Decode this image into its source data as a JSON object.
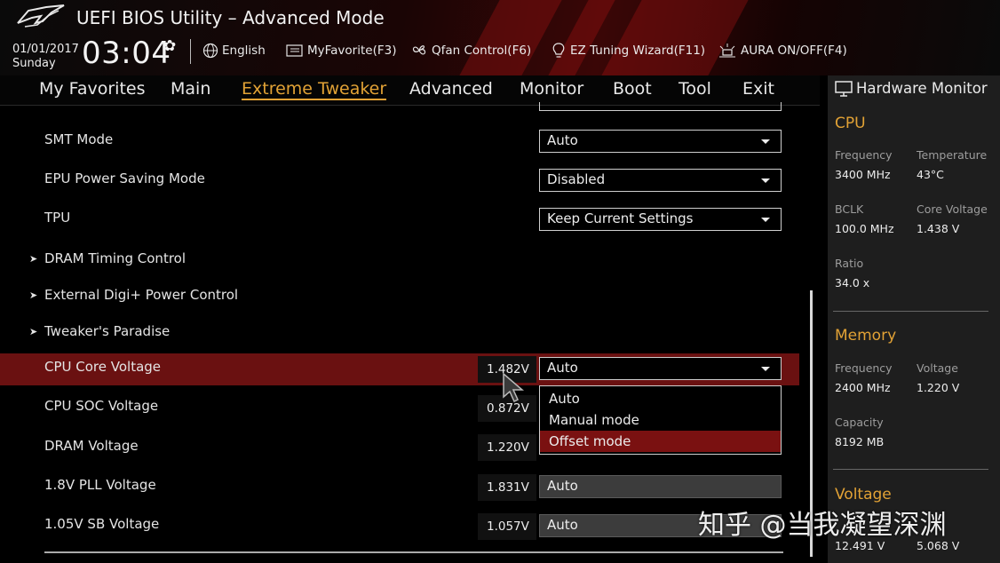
{
  "header": {
    "title": "UEFI BIOS Utility – Advanced Mode",
    "date": "01/01/2017",
    "day": "Sunday",
    "time": "03:04",
    "buttons": {
      "language": "English",
      "my_favorite": "MyFavorite(F3)",
      "qfan": "Qfan Control(F6)",
      "ez_tuning": "EZ Tuning Wizard(F11)",
      "aura": "AURA ON/OFF(F4)"
    }
  },
  "tabs": [
    {
      "label": "My Favorites"
    },
    {
      "label": "Main"
    },
    {
      "label": "Extreme Tweaker",
      "active": true
    },
    {
      "label": "Advanced"
    },
    {
      "label": "Monitor"
    },
    {
      "label": "Boot"
    },
    {
      "label": "Tool"
    },
    {
      "label": "Exit"
    }
  ],
  "settings": {
    "smt_mode": {
      "label": "SMT Mode",
      "value": "Auto"
    },
    "epu_power_saving": {
      "label": "EPU Power Saving Mode",
      "value": "Disabled"
    },
    "tpu": {
      "label": "TPU",
      "value": "Keep Current Settings"
    },
    "dram_timing": {
      "label": "DRAM Timing Control"
    },
    "external_digi": {
      "label": "External Digi+ Power Control"
    },
    "tweakers_paradise": {
      "label": "Tweaker's Paradise"
    },
    "cpu_core_voltage": {
      "label": "CPU Core Voltage",
      "reading": "1.482V",
      "value": "Auto"
    },
    "cpu_soc_voltage": {
      "label": "CPU SOC Voltage",
      "reading": "0.872V"
    },
    "dram_voltage": {
      "label": "DRAM Voltage",
      "reading": "1.220V"
    },
    "pll_voltage": {
      "label": "1.8V PLL Voltage",
      "reading": "1.831V",
      "value": "Auto"
    },
    "sb_voltage": {
      "label": "1.05V SB Voltage",
      "reading": "1.057V",
      "value": "Auto"
    }
  },
  "dropdown_options": [
    "Auto",
    "Manual mode",
    "Offset mode"
  ],
  "dropdown_selected": "Offset mode",
  "hardware_monitor": {
    "title": "Hardware Monitor",
    "cpu": {
      "heading": "CPU",
      "frequency_label": "Frequency",
      "frequency": "3400 MHz",
      "temperature_label": "Temperature",
      "temperature": "43°C",
      "bclk_label": "BCLK",
      "bclk": "100.0 MHz",
      "core_voltage_label": "Core Voltage",
      "core_voltage": "1.438 V",
      "ratio_label": "Ratio",
      "ratio": "34.0 x"
    },
    "memory": {
      "heading": "Memory",
      "frequency_label": "Frequency",
      "frequency": "2400 MHz",
      "voltage_label": "Voltage",
      "voltage": "1.220 V",
      "capacity_label": "Capacity",
      "capacity": "8192 MB"
    },
    "voltage": {
      "heading": "Voltage",
      "v12": "12.491 V",
      "v5": "5.068 V"
    }
  },
  "watermark": "知乎 @当我凝望深渊",
  "colors": {
    "accent": "#e2a235",
    "highlight_row": "#6a1111",
    "selected_option": "#7a1111",
    "panel_bg": "#1e1e1e"
  }
}
